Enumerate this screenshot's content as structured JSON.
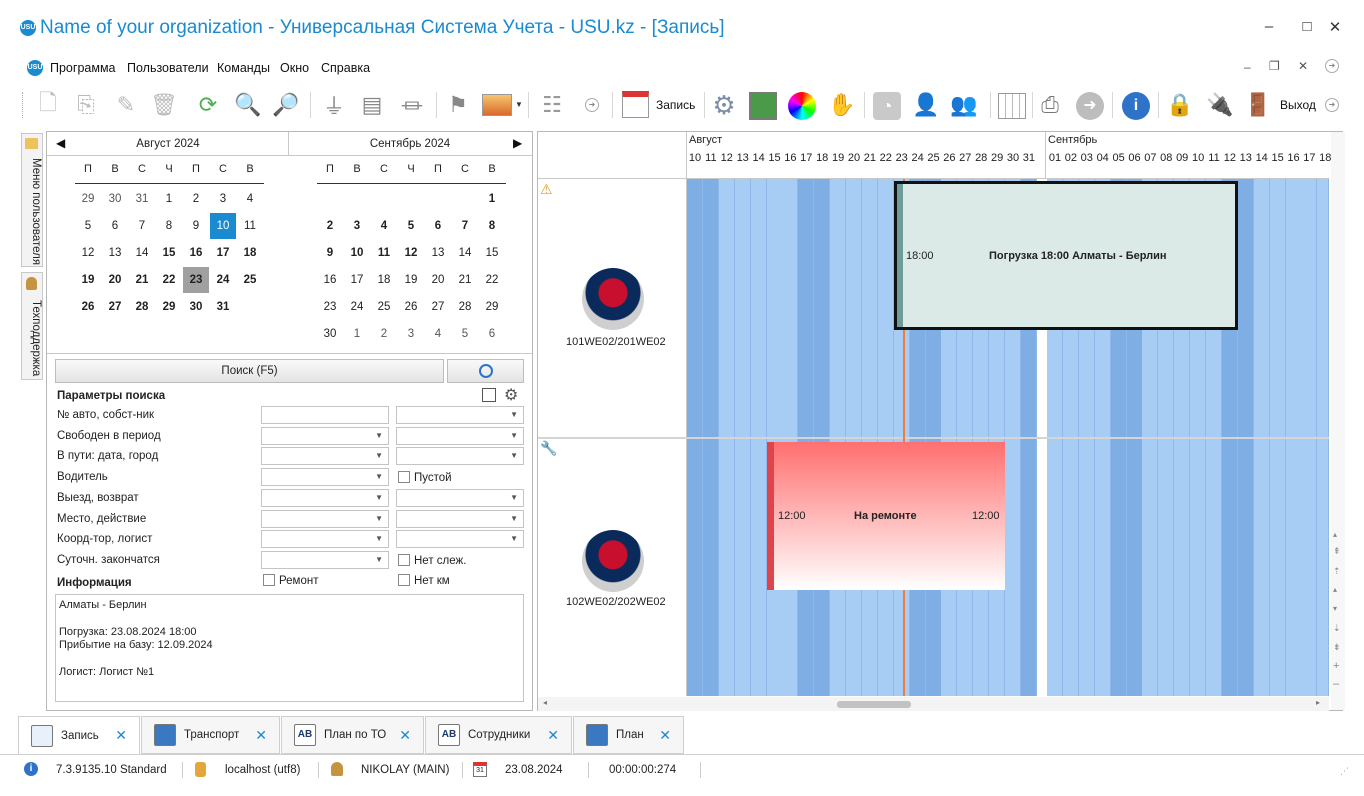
{
  "window": {
    "title": "Name of your organization - Универсальная Система Учета - USU.kz - [Запись]",
    "logo_text": "USU",
    "minimize": "–",
    "maximize": "□",
    "close": "✕"
  },
  "menu": {
    "items": [
      "Программа",
      "Пользователи",
      "Команды",
      "Окно",
      "Справка"
    ]
  },
  "toolbar": {
    "record_label": "Запись",
    "exit_label": "Выход",
    "icons": [
      "add-icon",
      "copy-icon",
      "edit-icon",
      "delete-icon",
      "refresh-icon",
      "search-icon",
      "search-advanced-icon",
      "filter-icon",
      "filter-table-icon",
      "filter-clear-icon",
      "flag-icon",
      "image-icon",
      "columns-icon",
      "calendar-icon",
      "gear-icon",
      "map-icon",
      "palette-icon",
      "hand-icon",
      "rss-icon",
      "user-icon",
      "users-icon",
      "grid-icon",
      "printer-icon",
      "arrow-right-icon",
      "info-icon",
      "lock-icon",
      "plug-icon",
      "exit-icon"
    ]
  },
  "side_tabs": [
    "Меню пользователя",
    "Техподдержка"
  ],
  "calendar": {
    "left": {
      "month": "Август 2024",
      "weekdays": [
        "П",
        "В",
        "С",
        "Ч",
        "П",
        "С",
        "В"
      ],
      "weeks": [
        [
          [
            "29",
            "g"
          ],
          [
            "30",
            "g"
          ],
          [
            "31",
            "g"
          ],
          [
            "1",
            ""
          ],
          [
            "2",
            ""
          ],
          [
            "3",
            ""
          ],
          [
            "4",
            ""
          ]
        ],
        [
          [
            "5",
            ""
          ],
          [
            "6",
            ""
          ],
          [
            "7",
            ""
          ],
          [
            "8",
            ""
          ],
          [
            "9",
            ""
          ],
          [
            "10",
            "today"
          ],
          [
            "11",
            ""
          ]
        ],
        [
          [
            "12",
            ""
          ],
          [
            "13",
            ""
          ],
          [
            "14",
            ""
          ],
          [
            "15",
            "b"
          ],
          [
            "16",
            "b"
          ],
          [
            "17",
            "b"
          ],
          [
            "18",
            "b"
          ]
        ],
        [
          [
            "19",
            "b"
          ],
          [
            "20",
            "b"
          ],
          [
            "21",
            "b"
          ],
          [
            "22",
            "b"
          ],
          [
            "23",
            "sel"
          ],
          [
            "24",
            "b"
          ],
          [
            "25",
            "b"
          ]
        ],
        [
          [
            "26",
            "b"
          ],
          [
            "27",
            "b"
          ],
          [
            "28",
            "b"
          ],
          [
            "29",
            "b"
          ],
          [
            "30",
            "b"
          ],
          [
            "31",
            "b"
          ],
          [
            "",
            ""
          ]
        ]
      ]
    },
    "right": {
      "month": "Сентябрь 2024",
      "weekdays": [
        "П",
        "В",
        "С",
        "Ч",
        "П",
        "С",
        "В"
      ],
      "weeks": [
        [
          [
            "",
            ""
          ],
          [
            "",
            ""
          ],
          [
            "",
            ""
          ],
          [
            "",
            ""
          ],
          [
            "",
            ""
          ],
          [
            "",
            ""
          ],
          [
            "1",
            "b"
          ]
        ],
        [
          [
            "2",
            "b"
          ],
          [
            "3",
            "b"
          ],
          [
            "4",
            "b"
          ],
          [
            "5",
            "b"
          ],
          [
            "6",
            "b"
          ],
          [
            "7",
            "b"
          ],
          [
            "8",
            "b"
          ]
        ],
        [
          [
            "9",
            "b"
          ],
          [
            "10",
            "b"
          ],
          [
            "11",
            "b"
          ],
          [
            "12",
            "b"
          ],
          [
            "13",
            ""
          ],
          [
            "14",
            ""
          ],
          [
            "15",
            ""
          ]
        ],
        [
          [
            "16",
            ""
          ],
          [
            "17",
            ""
          ],
          [
            "18",
            ""
          ],
          [
            "19",
            ""
          ],
          [
            "20",
            ""
          ],
          [
            "21",
            ""
          ],
          [
            "22",
            ""
          ]
        ],
        [
          [
            "23",
            ""
          ],
          [
            "24",
            ""
          ],
          [
            "25",
            ""
          ],
          [
            "26",
            ""
          ],
          [
            "27",
            ""
          ],
          [
            "28",
            ""
          ],
          [
            "29",
            ""
          ]
        ],
        [
          [
            "30",
            ""
          ],
          [
            "1",
            "g"
          ],
          [
            "2",
            "g"
          ],
          [
            "3",
            "g"
          ],
          [
            "4",
            "g"
          ],
          [
            "5",
            "g"
          ],
          [
            "6",
            "g"
          ]
        ]
      ]
    }
  },
  "search": {
    "button_label": "Поиск (F5)",
    "params_title": "Параметры поиска",
    "fields": [
      {
        "label": "№ авто, собст-ник"
      },
      {
        "label": "Свободен в период"
      },
      {
        "label": "В пути: дата, город"
      },
      {
        "label": "Водитель",
        "check": "Пустой"
      },
      {
        "label": "Выезд, возврат"
      },
      {
        "label": "Место, действие"
      },
      {
        "label": "Коорд-тор, логист"
      },
      {
        "label": "Суточн. закончатся",
        "check": "Нет слеж."
      }
    ],
    "repair_check": "Ремонт",
    "nokm_check": "Нет км"
  },
  "info": {
    "title": "Информация",
    "lines": [
      "Алматы - Берлин",
      "",
      "Погрузка: 23.08.2024 18:00",
      "Прибытие на базу: 12.09.2024",
      "",
      "Логист: Логист №1"
    ]
  },
  "schedule": {
    "month_aug": "Август",
    "month_sep": "Сентябрь",
    "aug_days": [
      "10",
      "11",
      "12",
      "13",
      "14",
      "15",
      "16",
      "17",
      "18",
      "19",
      "20",
      "21",
      "22",
      "23",
      "24",
      "25",
      "26",
      "27",
      "28",
      "29",
      "30",
      "31"
    ],
    "sep_days": [
      "01",
      "02",
      "03",
      "04",
      "05",
      "06",
      "07",
      "08",
      "09",
      "10",
      "11",
      "12",
      "13",
      "14",
      "15",
      "16",
      "17",
      "18"
    ],
    "vehicles": [
      {
        "plate": "101WE02/201WE02"
      },
      {
        "plate": "102WE02/202WE02"
      }
    ],
    "event1": {
      "time": "18:00",
      "title": "Погрузка 18:00 Алматы - Берлин"
    },
    "event2": {
      "time_start": "12:00",
      "title": "На ремонте",
      "time_end": "12:00"
    }
  },
  "tabs": [
    {
      "label": "Запись",
      "icon": "window-icon"
    },
    {
      "label": "Транспорт",
      "icon": "book-icon"
    },
    {
      "label": "План по ТО",
      "icon": "ab-icon"
    },
    {
      "label": "Сотрудники",
      "icon": "ab-icon"
    },
    {
      "label": "План",
      "icon": "book-icon"
    }
  ],
  "status": {
    "version": "7.3.9135.10 Standard",
    "db": "localhost (utf8)",
    "user": "NIKOLAY (MAIN)",
    "date": "23.08.2024",
    "timer": "00:00:00:274",
    "calendar_icon_text": "31"
  },
  "colors": {
    "accent": "#1a8ad1",
    "event_green": "#dbe9e7",
    "event_red": "#ff6f6f",
    "stripe_dark": "#7eaee3",
    "stripe_light": "#a8cdf5"
  }
}
